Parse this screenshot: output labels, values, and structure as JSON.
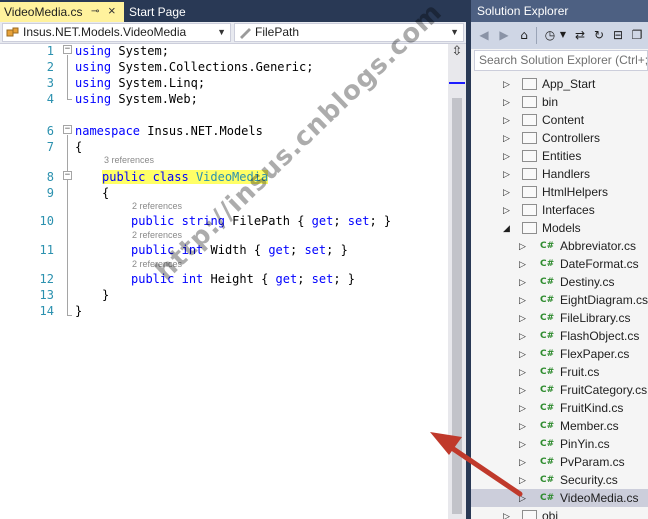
{
  "editor": {
    "tabs": [
      {
        "label": "VideoMedia.cs",
        "pin": "⊸",
        "close": "×",
        "active": true
      },
      {
        "label": "Start Page",
        "active": false
      }
    ],
    "nav": {
      "class_combo": "Insus.NET.Models.VideoMedia",
      "member_combo": "FilePath"
    },
    "line_numbers": [
      "1",
      "2",
      "3",
      "4",
      "5",
      "6",
      "7",
      "8",
      "9",
      "10",
      "11",
      "12",
      "13",
      "14"
    ],
    "code": {
      "l1": {
        "kw": "using",
        "rest": " System;"
      },
      "l2": {
        "kw": "using",
        "rest": " System.Collections.Generic;"
      },
      "l3": {
        "kw": "using",
        "rest": " System.Linq;"
      },
      "l4": {
        "kw": "using",
        "rest": " System.Web;"
      },
      "l6": {
        "kw": "namespace",
        "rest": " Insus.NET.Models"
      },
      "l7": "{",
      "ref_class": "3 references",
      "l8": {
        "kw1": "public",
        "kw2": " class ",
        "type": "VideoMedia"
      },
      "l9": "{",
      "ref_filepath": "2 references",
      "l10": {
        "kw1": "public",
        "kw2": "string",
        "name": " FilePath { ",
        "get": "get",
        "mid": "; ",
        "set": "set",
        "end": "; }"
      },
      "ref_width": "2 references",
      "l11": {
        "kw1": "public",
        "kw2": "int",
        "name": " Width { ",
        "get": "get",
        "mid": "; ",
        "set": "set",
        "end": "; }"
      },
      "ref_height": "2 references",
      "l12": {
        "kw1": "public",
        "kw2": "int",
        "name": " Height { ",
        "get": "get",
        "mid": "; ",
        "set": "set",
        "end": "; }"
      },
      "l13": "}",
      "l14": "}"
    }
  },
  "watermark": "http://insus.cnblogs.com",
  "solution_explorer": {
    "title": "Solution Explorer",
    "search_placeholder": "Search Solution Explorer (Ctrl+;)",
    "items": [
      {
        "label": "App_Start",
        "kind": "folder",
        "expanded": false
      },
      {
        "label": "bin",
        "kind": "folder",
        "expanded": false
      },
      {
        "label": "Content",
        "kind": "folder",
        "expanded": false
      },
      {
        "label": "Controllers",
        "kind": "folder",
        "expanded": false
      },
      {
        "label": "Entities",
        "kind": "folder",
        "expanded": false
      },
      {
        "label": "Handlers",
        "kind": "folder",
        "expanded": false
      },
      {
        "label": "HtmlHelpers",
        "kind": "folder",
        "expanded": false
      },
      {
        "label": "Interfaces",
        "kind": "folder",
        "expanded": false
      },
      {
        "label": "Models",
        "kind": "folder",
        "expanded": true
      },
      {
        "label": "Abbreviator.cs",
        "kind": "cs"
      },
      {
        "label": "DateFormat.cs",
        "kind": "cs"
      },
      {
        "label": "Destiny.cs",
        "kind": "cs"
      },
      {
        "label": "EightDiagram.cs",
        "kind": "cs"
      },
      {
        "label": "FileLibrary.cs",
        "kind": "cs"
      },
      {
        "label": "FlashObject.cs",
        "kind": "cs"
      },
      {
        "label": "FlexPaper.cs",
        "kind": "cs"
      },
      {
        "label": "Fruit.cs",
        "kind": "cs"
      },
      {
        "label": "FruitCategory.cs",
        "kind": "cs"
      },
      {
        "label": "FruitKind.cs",
        "kind": "cs"
      },
      {
        "label": "Member.cs",
        "kind": "cs"
      },
      {
        "label": "PinYin.cs",
        "kind": "cs"
      },
      {
        "label": "PvParam.cs",
        "kind": "cs"
      },
      {
        "label": "Security.cs",
        "kind": "cs"
      },
      {
        "label": "VideoMedia.cs",
        "kind": "cs",
        "selected": true
      },
      {
        "label": "obj",
        "kind": "folder",
        "expanded": false
      }
    ],
    "cs_icon_text": "C#"
  },
  "colors": {
    "accent": "#293955",
    "active_tab": "#FFF29D",
    "keyword": "#0000FF",
    "type": "#2B91AF",
    "highlight": "#FFFF66",
    "arrow": "#C0392B"
  }
}
